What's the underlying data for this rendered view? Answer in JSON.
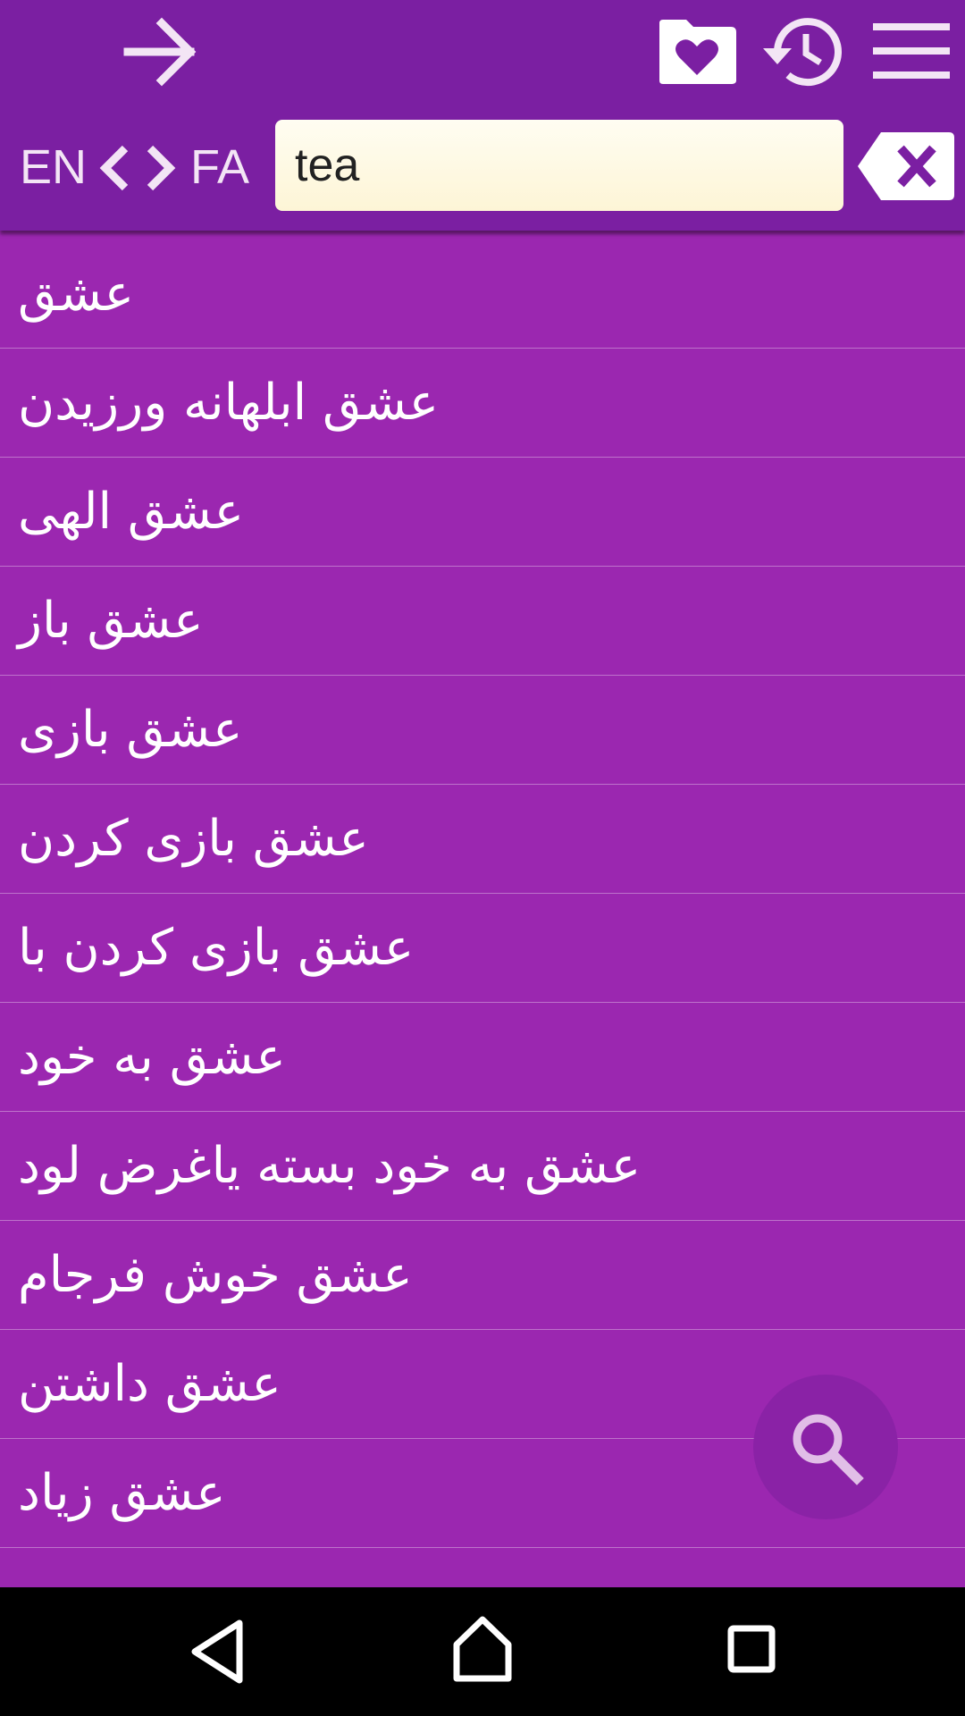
{
  "header": {
    "icons": {
      "forward": "arrow-right-icon",
      "favorites": "favorites-folder-icon",
      "history": "history-icon",
      "menu": "hamburger-menu-icon",
      "clear": "backspace-clear-icon"
    },
    "lang_from": "EN",
    "lang_to": "FA",
    "search": {
      "value": "tea",
      "placeholder": ""
    }
  },
  "results": [
    "عشق",
    "عشق ابلهانه ورزیدن",
    "عشق الهی",
    "عشق باز",
    "عشق بازی",
    "عشق بازی کردن",
    "عشق بازی کردن با",
    "عشق به خود",
    "عشق به خود بسته یاغرض لود",
    "عشق خوش فرجام",
    "عشق داشتن",
    "عشق زیاد"
  ],
  "fab": {
    "icon": "search-icon"
  },
  "navbar": {
    "icons": [
      "back-triangle-icon",
      "home-icon",
      "recents-icon"
    ]
  },
  "colors": {
    "appbar": "#7b1fa2",
    "list_background": "#9b27b0",
    "search_field": "#fdf5d6",
    "navbar": "#000000"
  }
}
